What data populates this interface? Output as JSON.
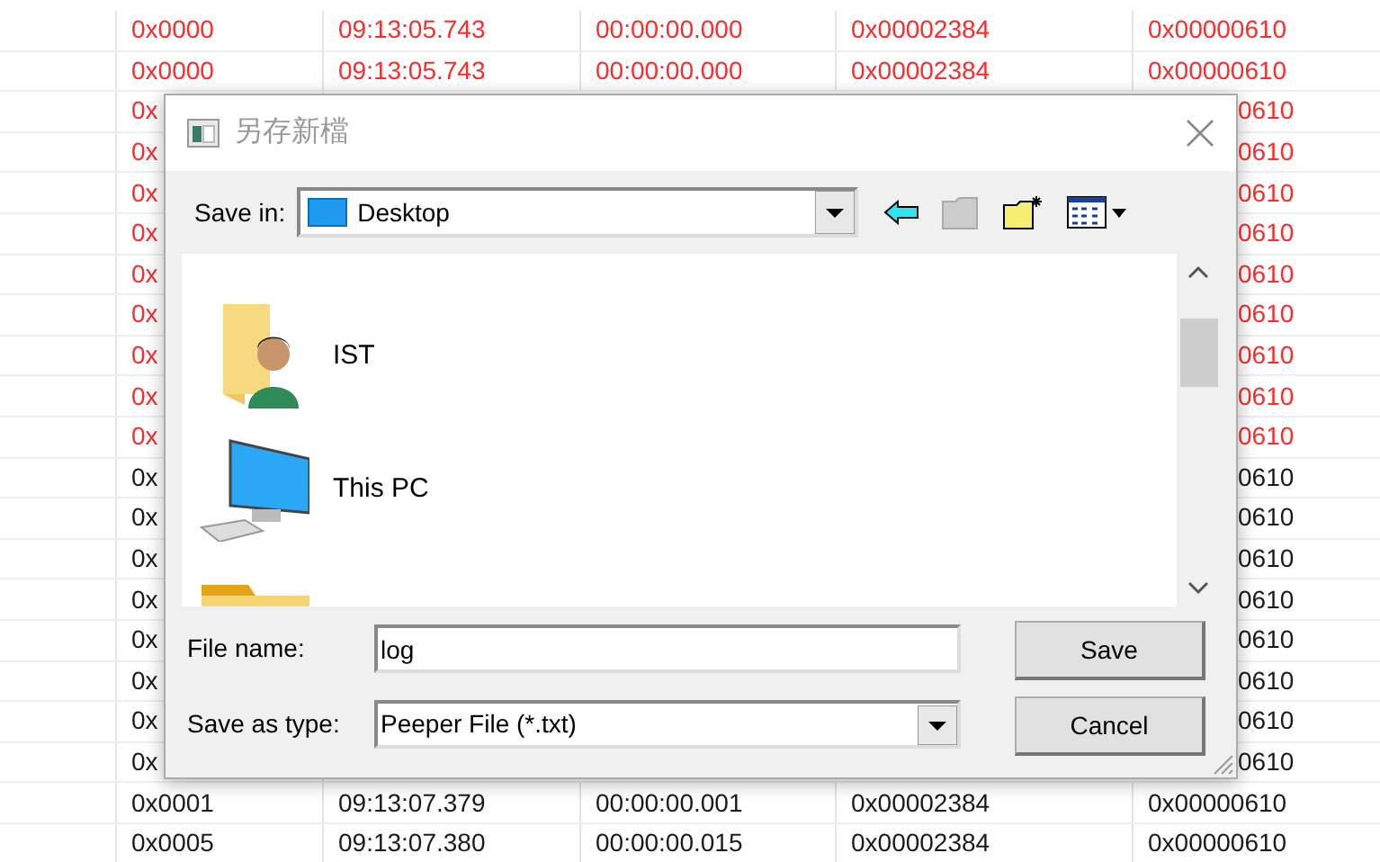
{
  "table": {
    "rows": [
      {
        "kind": "full",
        "highlighted": true,
        "cells": [
          "0x0000",
          "09:13:05.743",
          "00:00:00.000",
          "0x00002384",
          "0x00000610"
        ]
      },
      {
        "kind": "full",
        "highlighted": true,
        "cells": [
          "0x0000",
          "09:13:05.743",
          "00:00:00.000",
          "0x00002384",
          "0x00000610"
        ]
      },
      {
        "kind": "covered",
        "highlighted": true,
        "cells": [
          "0x",
          "0610"
        ]
      },
      {
        "kind": "covered",
        "highlighted": true,
        "cells": [
          "0x",
          "0610"
        ]
      },
      {
        "kind": "covered",
        "highlighted": true,
        "cells": [
          "0x",
          "0610"
        ]
      },
      {
        "kind": "covered",
        "highlighted": true,
        "cells": [
          "0x",
          "0610"
        ]
      },
      {
        "kind": "covered",
        "highlighted": true,
        "cells": [
          "0x",
          "0610"
        ]
      },
      {
        "kind": "covered",
        "highlighted": true,
        "cells": [
          "0x",
          "0610"
        ]
      },
      {
        "kind": "covered",
        "highlighted": true,
        "cells": [
          "0x",
          "0610"
        ]
      },
      {
        "kind": "covered",
        "highlighted": true,
        "cells": [
          "0x",
          "0610"
        ]
      },
      {
        "kind": "covered",
        "highlighted": true,
        "cells": [
          "0x",
          "0610"
        ]
      },
      {
        "kind": "covered",
        "highlighted": false,
        "cells": [
          "0x",
          "0610"
        ]
      },
      {
        "kind": "covered",
        "highlighted": false,
        "cells": [
          "0x",
          "0610"
        ]
      },
      {
        "kind": "covered",
        "highlighted": false,
        "cells": [
          "0x",
          "0610"
        ]
      },
      {
        "kind": "covered",
        "highlighted": false,
        "cells": [
          "0x",
          "0610"
        ]
      },
      {
        "kind": "covered",
        "highlighted": false,
        "cells": [
          "0x",
          "0610"
        ]
      },
      {
        "kind": "covered",
        "highlighted": false,
        "cells": [
          "0x",
          "0610"
        ]
      },
      {
        "kind": "covered",
        "highlighted": false,
        "cells": [
          "0x",
          "0610"
        ]
      },
      {
        "kind": "covered",
        "highlighted": false,
        "cells": [
          "0x",
          "0610"
        ]
      },
      {
        "kind": "full",
        "highlighted": false,
        "cells": [
          "0x0001",
          "09:13:07.379",
          "00:00:00.001",
          "0x00002384",
          "0x00000610"
        ]
      },
      {
        "kind": "full",
        "highlighted": false,
        "cells": [
          "0x0005",
          "09:13:07.380",
          "00:00:00.015",
          "0x00002384",
          "0x00000610"
        ]
      }
    ]
  },
  "dialog": {
    "title": "另存新檔",
    "save_in": {
      "label": "Save in:",
      "value": "Desktop"
    },
    "items": [
      {
        "kind": "user",
        "label": "IST"
      },
      {
        "kind": "pc",
        "label": "This PC"
      },
      {
        "kind": "folder"
      }
    ],
    "file_name": {
      "label": "File name:",
      "value": "log"
    },
    "save_as_type": {
      "label": "Save as type:",
      "value": "Peeper File (*.txt)"
    },
    "buttons": [
      "Save",
      "Cancel"
    ]
  }
}
